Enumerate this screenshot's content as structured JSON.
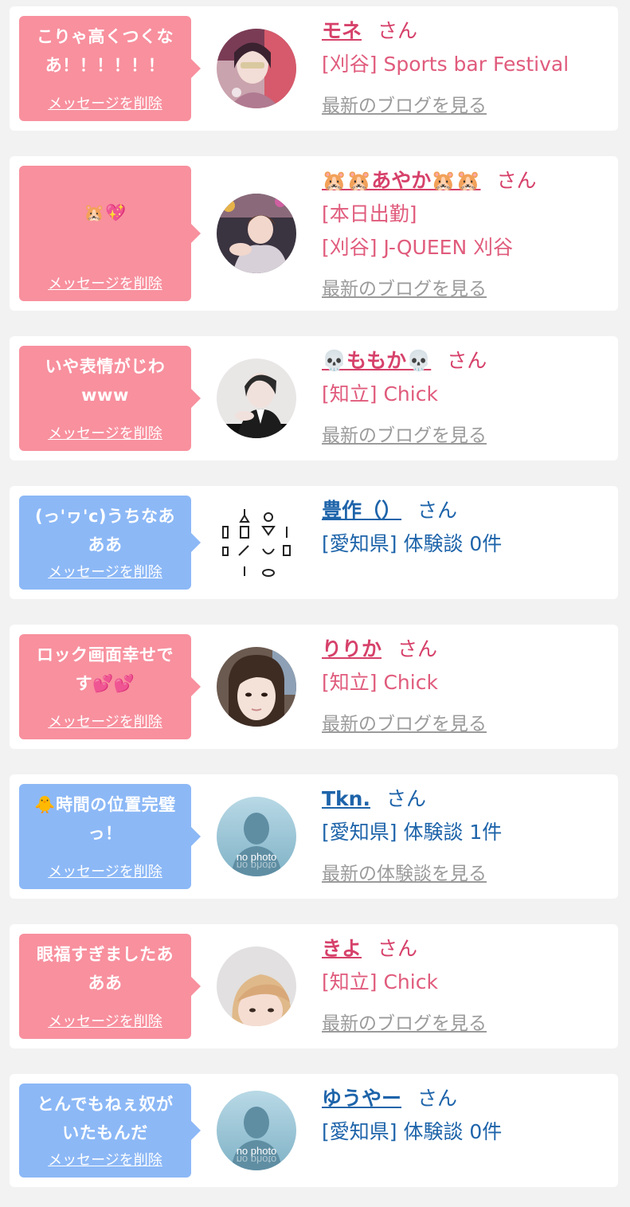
{
  "suffix": "さん",
  "delete_label": "メッセージを削除",
  "messages": [
    {
      "text": "こりゃ高くつくな\nあ！！！！！！",
      "name": "モネ",
      "details": [
        "[刈谷] Sports bar Festival"
      ],
      "link": "最新のブログを見る",
      "color": "pink",
      "avatar": "photo-costume"
    },
    {
      "text": "🐹💖",
      "name": "🐹🐹あやか🐹🐹",
      "details": [
        "[本日出勤]",
        "[刈谷] J-QUEEN 刈谷"
      ],
      "link": "最新のブログを見る",
      "color": "pink",
      "avatar": "photo-party"
    },
    {
      "text": "いや表情がじわ\nwww",
      "name": "💀ももか💀",
      "details": [
        "[知立] Chick"
      ],
      "link": "最新のブログを見る",
      "color": "pink",
      "avatar": "photo-bartender"
    },
    {
      "text": "(っ'ヮ'c)うちなあ\nああ",
      "name": "豊作（）",
      "details": [
        "[愛知県] 体験談 0件"
      ],
      "link": "",
      "color": "blue",
      "avatar": "icon-lab"
    },
    {
      "text": "ロック画面幸せで\nす💕💕",
      "name": "りりか",
      "details": [
        "[知立] Chick"
      ],
      "link": "最新のブログを見る",
      "color": "pink",
      "avatar": "photo-face"
    },
    {
      "text": "🐥時間の位置完璧\nっ！",
      "name": "Tkn.",
      "details": [
        "[愛知県] 体験談 1件"
      ],
      "link": "最新の体験談を見る",
      "color": "blue",
      "avatar": "no-photo"
    },
    {
      "text": "眼福すぎましたあ\nああ",
      "name": "きよ",
      "details": [
        "[知立] Chick"
      ],
      "link": "最新のブログを見る",
      "color": "pink",
      "avatar": "photo-blonde"
    },
    {
      "text": "とんでもねぇ奴が\nいたもんだ",
      "name": "ゆうやー",
      "details": [
        "[愛知県] 体験談 0件"
      ],
      "link": "",
      "color": "blue",
      "avatar": "no-photo"
    }
  ],
  "avatar_placeholder_text": "no photo"
}
